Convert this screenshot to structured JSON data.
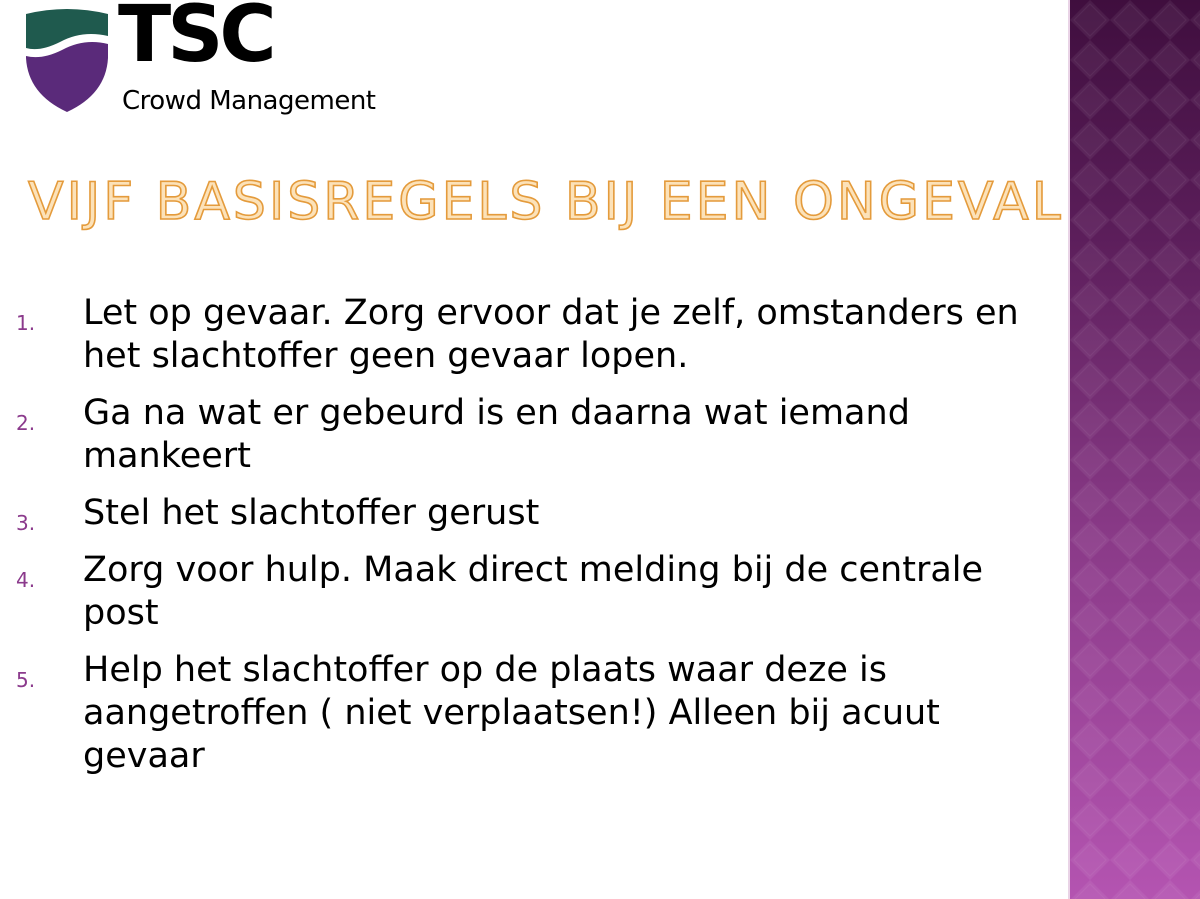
{
  "logo": {
    "wordmark": "TSC",
    "tagline": "Crowd Management",
    "icon": "shield-icon",
    "colors": {
      "teal": "#1f5a4e",
      "purple": "#5a2a7a"
    }
  },
  "title": "VIJF BASISREGELS BIJ EEN ONGEVAL",
  "rules": [
    {
      "number": "1.",
      "text": "Let op gevaar. Zorg ervoor dat je zelf, omstanders en het slachtoffer geen gevaar lopen."
    },
    {
      "number": "2.",
      "text": "Ga na wat er gebeurd is en daarna wat iemand mankeert"
    },
    {
      "number": "3.",
      "text": "Stel het slachtoffer gerust"
    },
    {
      "number": "4.",
      "text": "Zorg voor hulp. Maak direct melding bij de centrale post"
    },
    {
      "number": "5.",
      "text": "Help het slachtoffer op de plaats waar deze is aangetroffen ( niet verplaatsen!) Alleen bij acuut gevaar"
    }
  ],
  "theme": {
    "accent": "#8b3a8c",
    "title_fill": "#fce2b9",
    "title_outline": "#e49b3c",
    "band_top": "#3f0e3e",
    "band_bottom": "#b454b1"
  }
}
